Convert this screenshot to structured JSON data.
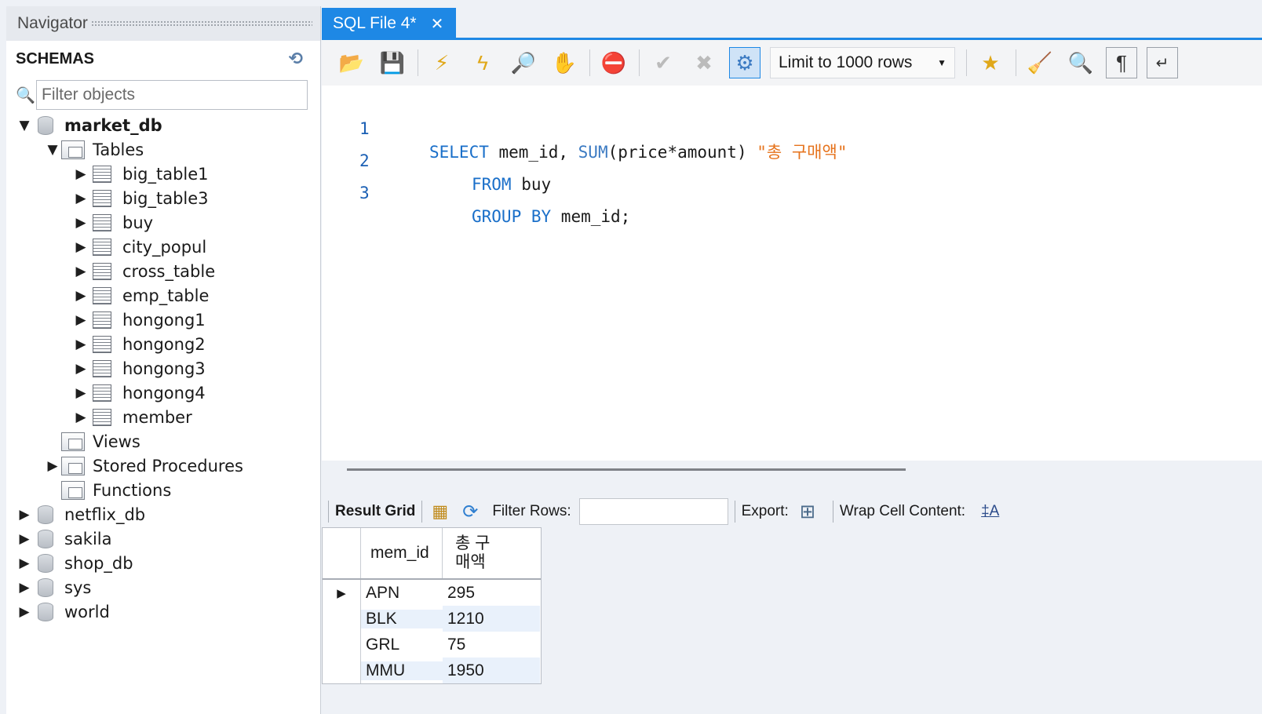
{
  "navigator": {
    "title": "Navigator",
    "schemas_label": "SCHEMAS",
    "filter_placeholder": "Filter objects",
    "tree": {
      "market_db": "market_db",
      "tables_label": "Tables",
      "tables": [
        "big_table1",
        "big_table3",
        "buy",
        "city_popul",
        "cross_table",
        "emp_table",
        "hongong1",
        "hongong2",
        "hongong3",
        "hongong4",
        "member"
      ],
      "views_label": "Views",
      "procedures_label": "Stored Procedures",
      "functions_label": "Functions",
      "other_dbs": [
        "netflix_db",
        "sakila",
        "shop_db",
        "sys",
        "world"
      ]
    }
  },
  "editor": {
    "tab_label": "SQL File 4*",
    "limit_label": "Limit to 1000 rows",
    "code": {
      "line_numbers": [
        "1",
        "2",
        "3"
      ],
      "l1_kw": "SELECT",
      "l1_a": " mem_id, ",
      "l1_fn": "SUM",
      "l1_b": "(price*amount) ",
      "l1_str": "\"총 구매액\"",
      "l2_kw": "FROM",
      "l2_a": " buy",
      "l3_kw": "GROUP BY",
      "l3_a": " mem_id;"
    }
  },
  "results": {
    "result_grid_label": "Result Grid",
    "filter_rows_label": "Filter Rows:",
    "export_label": "Export:",
    "wrap_label": "Wrap Cell Content:",
    "columns": [
      "mem_id",
      "총 구매액"
    ],
    "column2_lines": [
      "총 구",
      "매액"
    ],
    "rows": [
      {
        "mem_id": "APN",
        "total": "295"
      },
      {
        "mem_id": "BLK",
        "total": "1210"
      },
      {
        "mem_id": "GRL",
        "total": "75"
      },
      {
        "mem_id": "MMU",
        "total": "1950"
      }
    ]
  },
  "colors": {
    "accent": "#1e88e5",
    "keyword": "#1a6fc9",
    "string": "#e6731c"
  }
}
